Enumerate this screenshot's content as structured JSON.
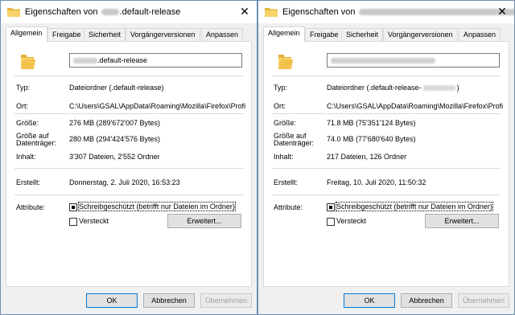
{
  "windows": [
    {
      "title_prefix": "Eigenschaften von",
      "title_suffix": ".default-release",
      "tabs": [
        "Allgemein",
        "Freigabe",
        "Sicherheit",
        "Vorgängerversionen",
        "Anpassen"
      ],
      "name_suffix": ".default-release",
      "rows": {
        "typ_label": "Typ:",
        "typ_value": "Dateiordner (.default-release)",
        "ort_label": "Ort:",
        "ort_value": "C:\\Users\\GSAL\\AppData\\Roaming\\Mozilla\\Firefox\\Profi",
        "groesse_label": "Größe:",
        "groesse_value": "276 MB (289'672'007 Bytes)",
        "datentraeger_label_1": "Größe auf",
        "datentraeger_label_2": "Datenträger:",
        "datentraeger_value": "280 MB (294'424'576 Bytes)",
        "inhalt_label": "Inhalt:",
        "inhalt_value": "3'307 Dateien, 2'552 Ordner",
        "erstellt_label": "Erstellt:",
        "erstellt_value": "Donnerstag, 2. Juli 2020, 16:53:23",
        "attribute_label": "Attribute:"
      },
      "readonly_label": "Schreibgeschützt (betrifft nur Dateien im Ordner)",
      "hidden_label": "Versteckt",
      "advanced_label": "Erweitert...",
      "ok_label": "OK",
      "cancel_label": "Abbrechen",
      "apply_label": "Übernehmen"
    },
    {
      "title_prefix": "Eigenschaften von",
      "title_suffix": "",
      "tabs": [
        "Allgemein",
        "Freigabe",
        "Sicherheit",
        "Vorgängerversionen",
        "Anpassen"
      ],
      "name_suffix": "",
      "rows": {
        "typ_label": "Typ:",
        "typ_value_prefix": "Dateiordner (.default-release-",
        "typ_value_suffix": ")",
        "ort_label": "Ort:",
        "ort_value": "C:\\Users\\GSAL\\AppData\\Roaming\\Mozilla\\Firefox\\Profi",
        "groesse_label": "Größe:",
        "groesse_value": "71.8 MB (75'351'124 Bytes)",
        "datentraeger_label_1": "Größe auf",
        "datentraeger_label_2": "Datenträger:",
        "datentraeger_value": "74.0 MB (77'680'640 Bytes)",
        "inhalt_label": "Inhalt:",
        "inhalt_value": "217 Dateien, 126 Ordner",
        "erstellt_label": "Erstellt:",
        "erstellt_value": "Freitag, 10. Juli 2020, 11:50:32",
        "attribute_label": "Attribute:"
      },
      "readonly_label": "Schreibgeschützt (betrifft nur Dateien im Ordner)",
      "hidden_label": "Versteckt",
      "advanced_label": "Erweitert...",
      "ok_label": "OK",
      "cancel_label": "Abbrechen",
      "apply_label": "Übernehmen"
    }
  ],
  "colors": {
    "folder": "#f0c44c",
    "accent": "#0078d7",
    "window_border": "#6d8fb5"
  },
  "icons": {
    "app": "folder-icon",
    "close": "close-icon"
  }
}
